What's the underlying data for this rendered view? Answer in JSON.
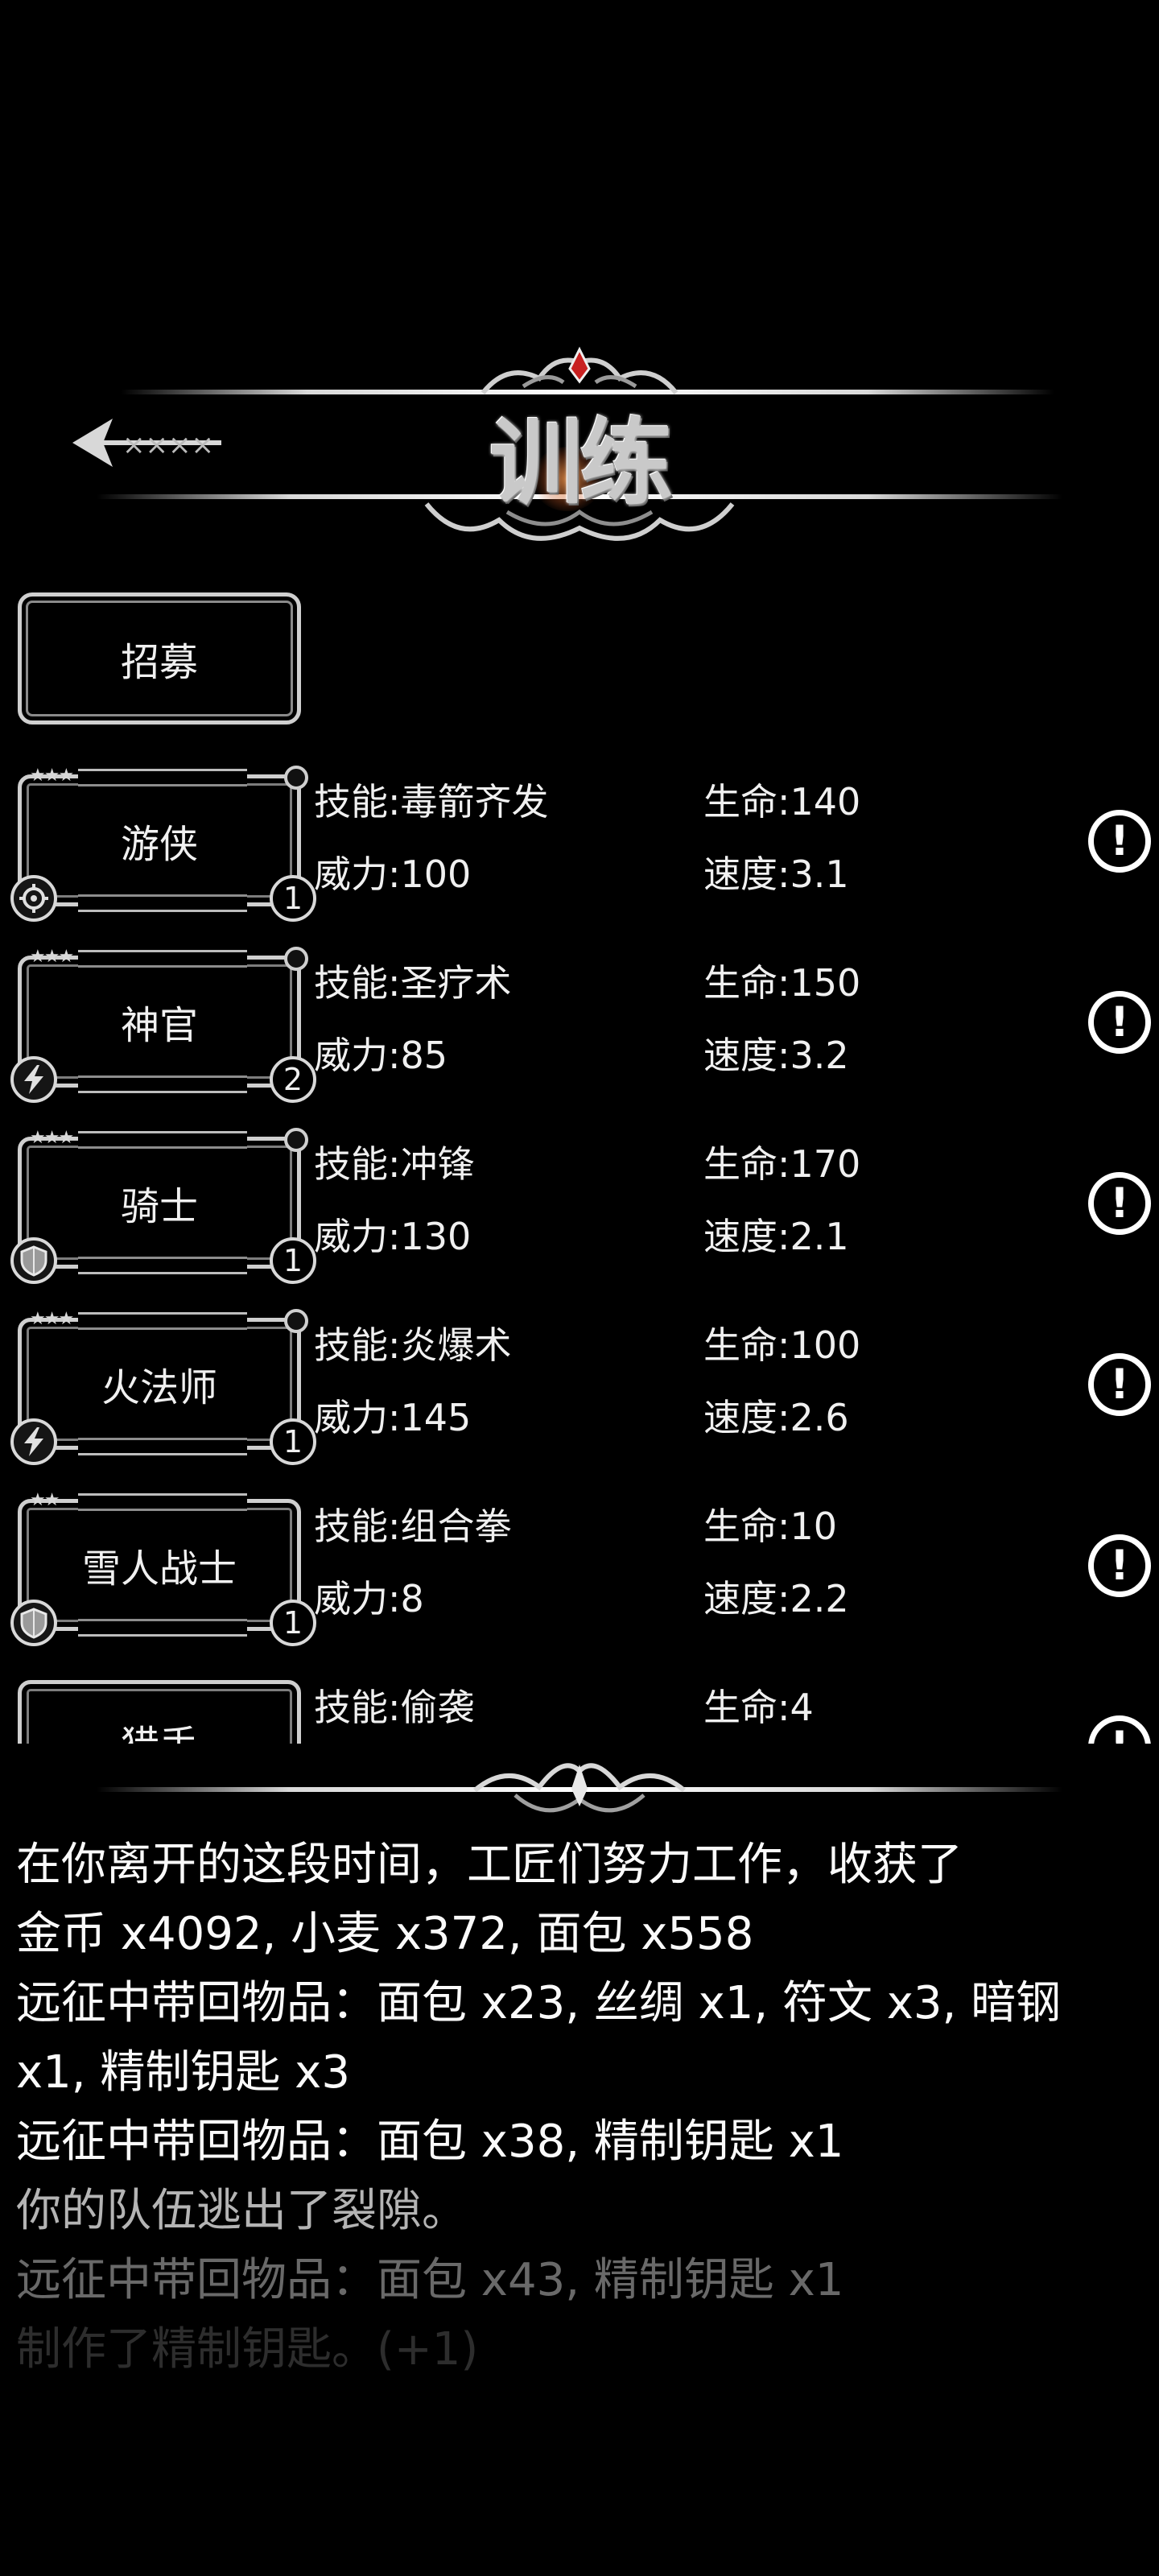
{
  "header": {
    "title": "训练"
  },
  "recruit_button": {
    "label": "招募"
  },
  "stat_labels": {
    "skill": "技能:",
    "power": "威力:",
    "life": "生命:",
    "speed": "速度:"
  },
  "units": [
    {
      "name": "游侠",
      "stars": "★★★",
      "level": "1",
      "class_icon": "crosshair-icon",
      "skill": "毒箭齐发",
      "power": "100",
      "life": "140",
      "speed": "3.1"
    },
    {
      "name": "神官",
      "stars": "★★★",
      "level": "2",
      "class_icon": "lightning-icon",
      "skill": "圣疗术",
      "power": "85",
      "life": "150",
      "speed": "3.2"
    },
    {
      "name": "骑士",
      "stars": "★★★",
      "level": "1",
      "class_icon": "shield-icon",
      "skill": "冲锋",
      "power": "130",
      "life": "170",
      "speed": "2.1"
    },
    {
      "name": "火法师",
      "stars": "★★★",
      "level": "1",
      "class_icon": "lightning-icon",
      "skill": "炎爆术",
      "power": "145",
      "life": "100",
      "speed": "2.6"
    },
    {
      "name": "雪人战士",
      "stars": "★★",
      "level": "1",
      "class_icon": "shield-icon",
      "skill": "组合拳",
      "power": "8",
      "life": "10",
      "speed": "2.2"
    },
    {
      "name": "猎手",
      "stars": "",
      "level": "",
      "class_icon": "",
      "skill": "偷袭",
      "power": "",
      "life": "4",
      "speed": ""
    }
  ],
  "info_icon": "!",
  "log": [
    {
      "text": "在你离开的这段时间，工匠们努力工作，收获了",
      "opacity": 1
    },
    {
      "text": "金币 x4092, 小麦 x372, 面包 x558",
      "opacity": 1
    },
    {
      "text": "远征中带回物品：面包 x23, 丝绸 x1, 符文 x3, 暗钢",
      "opacity": 1
    },
    {
      "text": "x1, 精制钥匙 x3",
      "opacity": 1
    },
    {
      "text": "远征中带回物品：面包 x38, 精制钥匙 x1",
      "opacity": 1
    },
    {
      "text": "你的队伍逃出了裂隙。",
      "opacity": 0.72
    },
    {
      "text": "远征中带回物品：面包 x43, 精制钥匙 x1",
      "opacity": 0.42
    },
    {
      "text": "制作了精制钥匙。(+1)",
      "opacity": 0.18
    }
  ]
}
